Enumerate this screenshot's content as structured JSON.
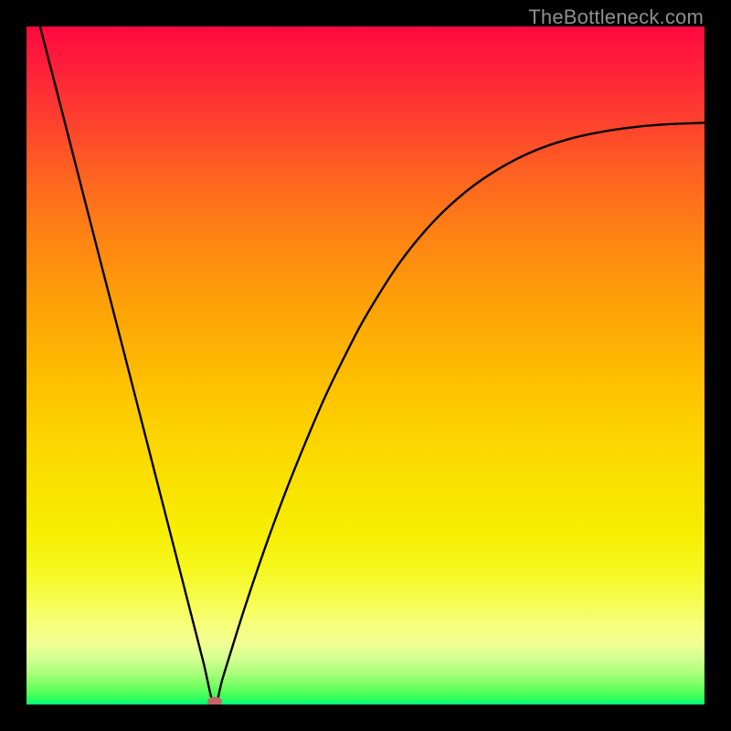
{
  "watermark": "TheBottleneck.com",
  "colors": {
    "background": "#000000",
    "curve": "#000000",
    "marker": "#c66565",
    "watermark": "#8f8f8f"
  },
  "chart_data": {
    "type": "line",
    "title": "",
    "xlabel": "",
    "ylabel": "",
    "xlim": [
      0,
      100
    ],
    "ylim": [
      0,
      100
    ],
    "grid": false,
    "legend": false,
    "series": [
      {
        "name": "bottleneck-curve",
        "x": [
          2,
          5,
          8,
          11,
          14,
          17,
          20,
          23,
          26,
          27.7,
          29,
          32,
          35,
          38,
          41,
          44,
          47,
          50,
          55,
          60,
          65,
          70,
          75,
          80,
          85,
          90,
          95,
          100
        ],
        "values": [
          100,
          88.4,
          76.7,
          65.0,
          53.4,
          41.7,
          30.0,
          18.3,
          6.6,
          0,
          4.1,
          13.7,
          22.6,
          30.8,
          38.3,
          45.3,
          51.5,
          57.2,
          65.1,
          71.2,
          75.8,
          79.2,
          81.7,
          83.4,
          84.5,
          85.2,
          85.6,
          85.8
        ]
      }
    ],
    "min_marker": {
      "x": 27.7,
      "y": 0
    },
    "gradient_stops": [
      {
        "pos": 0,
        "color": "#fe093f"
      },
      {
        "pos": 0.25,
        "color": "#fe7717"
      },
      {
        "pos": 0.5,
        "color": "#feba01"
      },
      {
        "pos": 0.75,
        "color": "#f7ef04"
      },
      {
        "pos": 0.92,
        "color": "#ecff90"
      },
      {
        "pos": 1.0,
        "color": "#01fe7a"
      }
    ]
  }
}
